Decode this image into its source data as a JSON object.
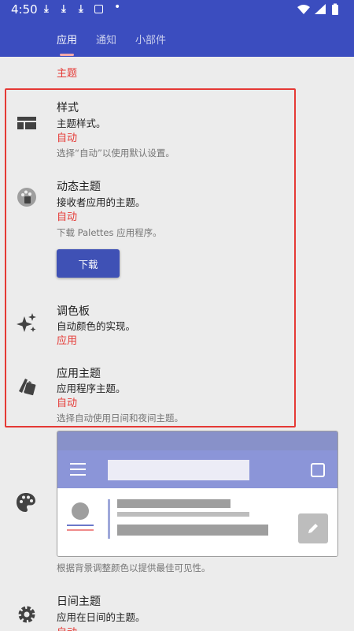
{
  "status_bar": {
    "time": "4:50",
    "dot": "•"
  },
  "tabs": [
    {
      "label": "应用",
      "active": true
    },
    {
      "label": "通知",
      "active": false
    },
    {
      "label": "小部件",
      "active": false
    }
  ],
  "section": {
    "header": "主题"
  },
  "prefs": {
    "style": {
      "title": "样式",
      "summary": "主题样式。",
      "value": "自动",
      "hint": "选择“自动”以使用默认设置。"
    },
    "dynamic": {
      "title": "动态主题",
      "summary": "接收者应用的主题。",
      "value": "自动",
      "hint": "下载 Palettes 应用程序。",
      "button": "下载"
    },
    "palette": {
      "title": "调色板",
      "summary": "自动颜色的实现。",
      "value": "应用"
    },
    "app_theme": {
      "title": "应用主题",
      "summary": "应用程序主题。",
      "value": "自动",
      "hint": "选择自动使用日间和夜间主题。"
    },
    "day_theme": {
      "title": "日间主题",
      "summary": "应用在日间的主题。",
      "value": "自动"
    }
  },
  "preview": {
    "caption": "根据背景调整颜色以提供最佳可见性。"
  },
  "colors": {
    "primary": "#3b4dbf",
    "accent": "#e53935",
    "button": "#3f51b5"
  }
}
